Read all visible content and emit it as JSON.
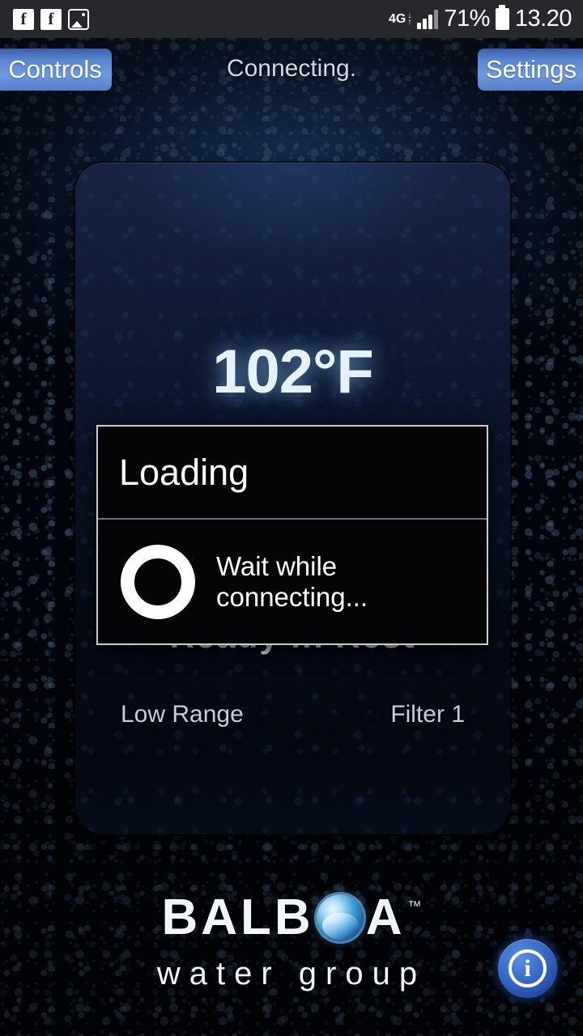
{
  "status_bar": {
    "left_icons": [
      {
        "name": "facebook-icon",
        "glyph": "f"
      },
      {
        "name": "facebook-icon",
        "glyph": "f"
      },
      {
        "name": "gallery-icon",
        "glyph": "image"
      }
    ],
    "network_type": "4G",
    "network_arrows_down": "↓",
    "network_arrows_up": "↑",
    "signal_bars_filled": 3,
    "signal_bars_total": 4,
    "battery_percent": "71%",
    "clock": "13.20",
    "background_color": "#26282b"
  },
  "nav": {
    "left_button": "Controls",
    "title": "Connecting.",
    "right_button": "Settings",
    "button_color": "#6d9ae0"
  },
  "panel": {
    "temperature": "102°F",
    "temperature_color": "#e4f3fb",
    "status": "Ready  in  Rest",
    "range_label": "Low Range",
    "filter_label": "Filter 1"
  },
  "dialog": {
    "title": "Loading",
    "message": "Wait while connecting...",
    "spinner_name": "loading-spinner",
    "border_color": "#c9ccd2",
    "background_color": "#050507"
  },
  "logo": {
    "part1": "BALB",
    "swirl": "water-drop-swirl",
    "part2": "A",
    "trademark": "™",
    "subtitle": "water group"
  },
  "info_button": {
    "glyph": "i",
    "label": "info-button",
    "color": "#3566c4"
  }
}
